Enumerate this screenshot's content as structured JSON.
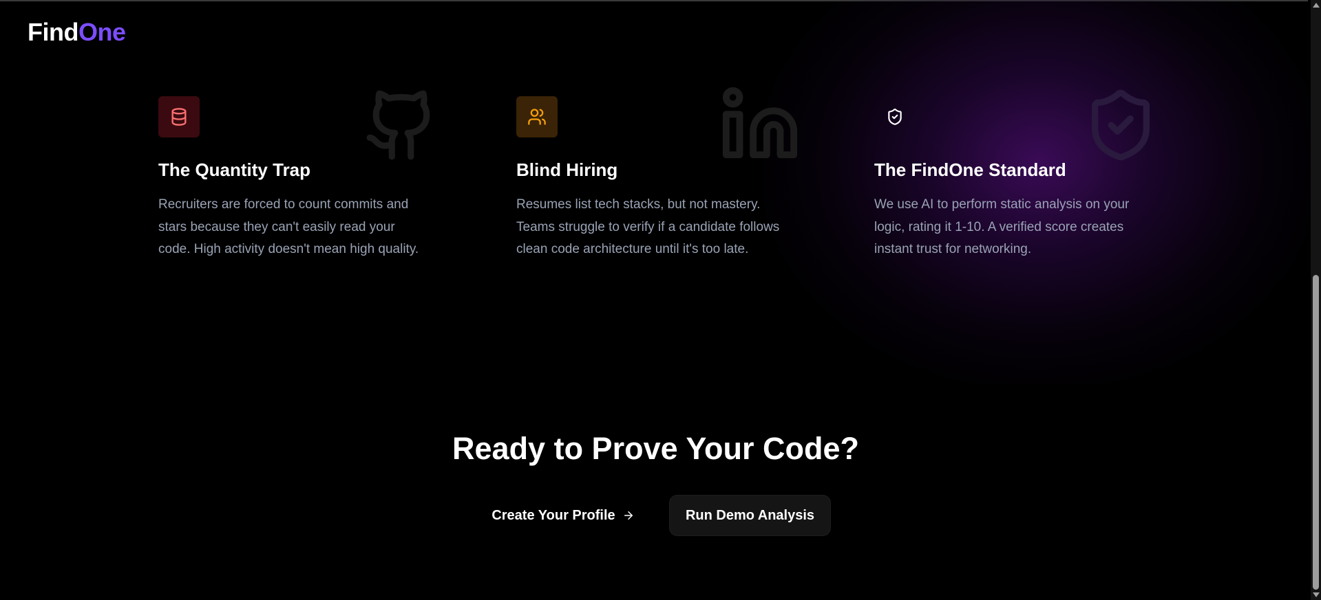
{
  "header": {
    "logo_part1": "Find",
    "logo_part2": "One"
  },
  "features": [
    {
      "title": "The Quantity Trap",
      "description": "Recruiters are forced to count commits and stars because they can't easily read your code. High activity doesn't mean high quality.",
      "icon": "database-icon",
      "background_icon": "github-icon",
      "accent_color": "#f87171",
      "icon_bg": "#3b0a10"
    },
    {
      "title": "Blind Hiring",
      "description": "Resumes list tech stacks, but not mastery. Teams struggle to verify if a candidate follows clean code architecture until it's too late.",
      "icon": "users-icon",
      "background_icon": "linkedin-icon",
      "accent_color": "#f59e0b",
      "icon_bg": "#3a2306"
    },
    {
      "title": "The FindOne Standard",
      "description": "We use AI to perform static analysis on your logic, rating it 1-10. A verified score creates instant trust for networking.",
      "icon": "shield-check-icon",
      "background_icon": "shield-check-icon",
      "accent_color": "#ffffff",
      "icon_bg": "transparent"
    }
  ],
  "cta": {
    "title": "Ready to Prove Your Code?",
    "primary_label": "Create Your Profile",
    "primary_icon": "arrow-right-icon",
    "secondary_label": "Run Demo Analysis"
  },
  "colors": {
    "background": "#000000",
    "brand": "#7c4dff",
    "text_muted": "#9aa3b5",
    "glow": "#4a0e6e"
  }
}
